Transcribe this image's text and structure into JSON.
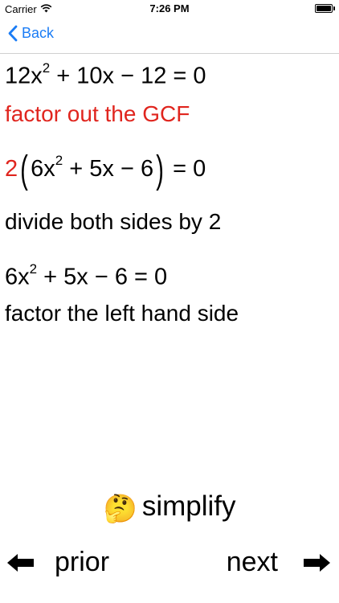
{
  "status": {
    "carrier": "Carrier",
    "time": "7:26 PM"
  },
  "nav": {
    "back_label": "Back"
  },
  "steps": {
    "eq1": {
      "lead": "12x",
      "exp": "2",
      "rest": " + 10x − 12 = 0"
    },
    "note1": "factor out the GCF",
    "eq2": {
      "gcf": "2",
      "inner_lead": "6x",
      "exp": "2",
      "inner_rest": " + 5x − 6",
      "tail": " = 0"
    },
    "note2": "divide both sides by 2",
    "eq3": {
      "lead": "6x",
      "exp": "2",
      "rest": " + 5x − 6 = 0"
    },
    "note3": "factor the left hand side"
  },
  "controls": {
    "simplify_emoji": "🤔",
    "simplify_label": "simplify",
    "prior_label": "prior",
    "next_label": "next",
    "prior_arrow": "⬅",
    "next_arrow": "➡"
  }
}
